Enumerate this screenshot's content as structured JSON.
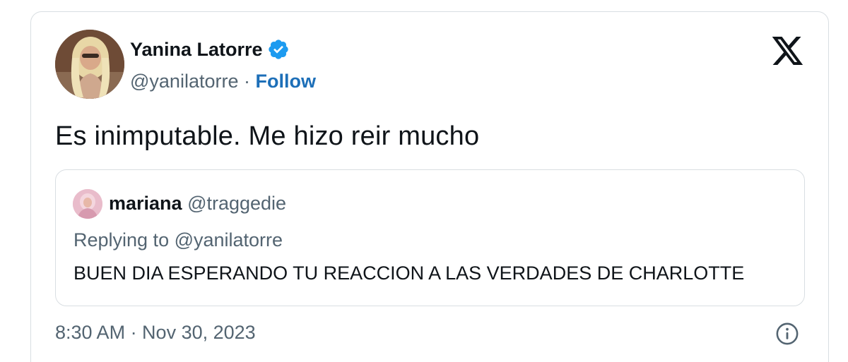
{
  "author": {
    "name": "Yanina Latorre",
    "handle": "@yanilatorre",
    "separator": " · ",
    "follow_label": "Follow",
    "verified_icon": "verified-badge-icon"
  },
  "logo_icon": "x-logo-icon",
  "tweet": {
    "text": "Es inimputable. Me hizo reir mucho",
    "timestamp": "8:30 AM · Nov 30, 2023"
  },
  "quote": {
    "name": "mariana",
    "handle": "@traggedie",
    "replying_to": "Replying to @yanilatorre",
    "text": "BUEN DIA ESPERANDO TU REACCION A LAS VERDADES DE CHARLOTTE"
  },
  "info_icon": "info-icon",
  "colors": {
    "text": "#0f1419",
    "secondary": "#536471",
    "link": "#1d6fb8",
    "verified": "#1d9bf0",
    "border": "#d9dee2"
  }
}
